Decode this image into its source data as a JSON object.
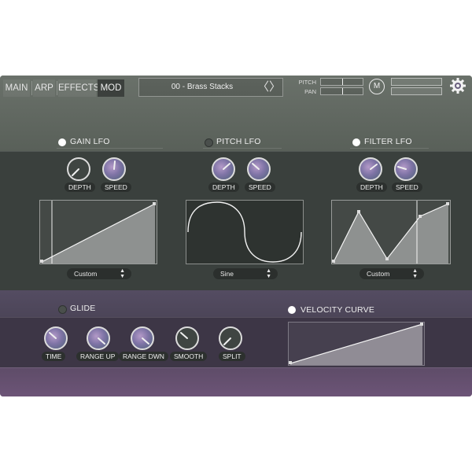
{
  "tabs": [
    {
      "label": "MAIN",
      "active": false
    },
    {
      "label": "ARP",
      "active": false
    },
    {
      "label": "EFFECTS",
      "active": false
    },
    {
      "label": "MOD",
      "active": true
    }
  ],
  "preset": {
    "name": "00 - Brass Stacks",
    "nav_glyph": "〈〉"
  },
  "mini": {
    "pitch_label": "PITCH",
    "pan_label": "PAN",
    "m_label": "M"
  },
  "sections": {
    "gain_lfo": {
      "title": "GAIN LFO",
      "enabled": true,
      "depth_label": "DEPTH",
      "speed_label": "SPEED",
      "shape": "Custom"
    },
    "pitch_lfo": {
      "title": "PITCH LFO",
      "enabled": false,
      "depth_label": "DEPTH",
      "speed_label": "SPEED",
      "shape": "Sine"
    },
    "filter_lfo": {
      "title": "FILTER LFO",
      "enabled": true,
      "depth_label": "DEPTH",
      "speed_label": "SPEED",
      "shape": "Custom"
    },
    "glide": {
      "title": "GLIDE",
      "enabled": false,
      "knobs": [
        "TIME",
        "RANGE UP",
        "RANGE DWN",
        "SMOOTH",
        "SPLIT"
      ]
    },
    "velocity_curve": {
      "title": "VELOCITY CURVE",
      "enabled": true
    }
  },
  "colors": {
    "accent_on": "#ffffff",
    "knob_ring": "#dcdcdc",
    "label_bg": "#2c302e"
  }
}
